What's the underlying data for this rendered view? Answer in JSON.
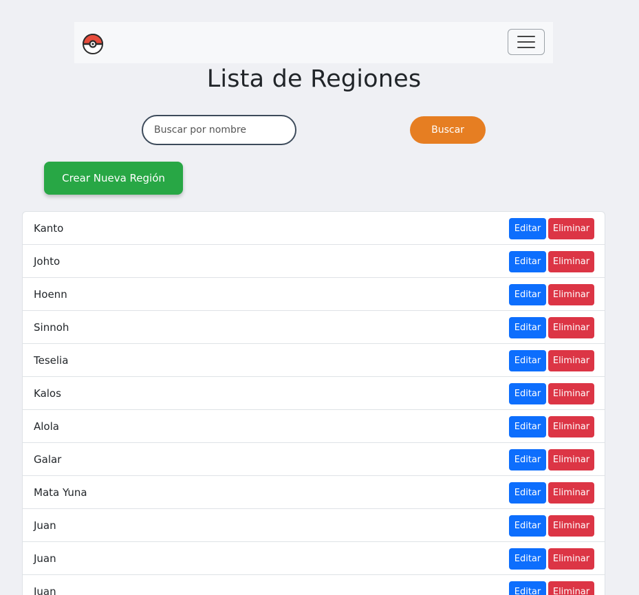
{
  "navbar": {
    "logo_icon": "pokeball-icon",
    "toggler_icon": "hamburger-menu-icon"
  },
  "page": {
    "title": "Lista de Regiones"
  },
  "search": {
    "placeholder": "Buscar por nombre",
    "value": "",
    "button_label": "Buscar"
  },
  "create_button_label": "Crear Nueva Región",
  "regions": {
    "edit_label": "Editar",
    "delete_label": "Eliminar",
    "items": [
      "Kanto",
      "Johto",
      "Hoenn",
      "Sinnoh",
      "Teselia",
      "Kalos",
      "Alola",
      "Galar",
      "Mata Yuna",
      "Juan",
      "Juan",
      "Juan"
    ]
  },
  "colors": {
    "search_button": "#e67e22",
    "create_button": "#28a745",
    "edit_button": "#0d6efd",
    "delete_button": "#dc3545"
  }
}
